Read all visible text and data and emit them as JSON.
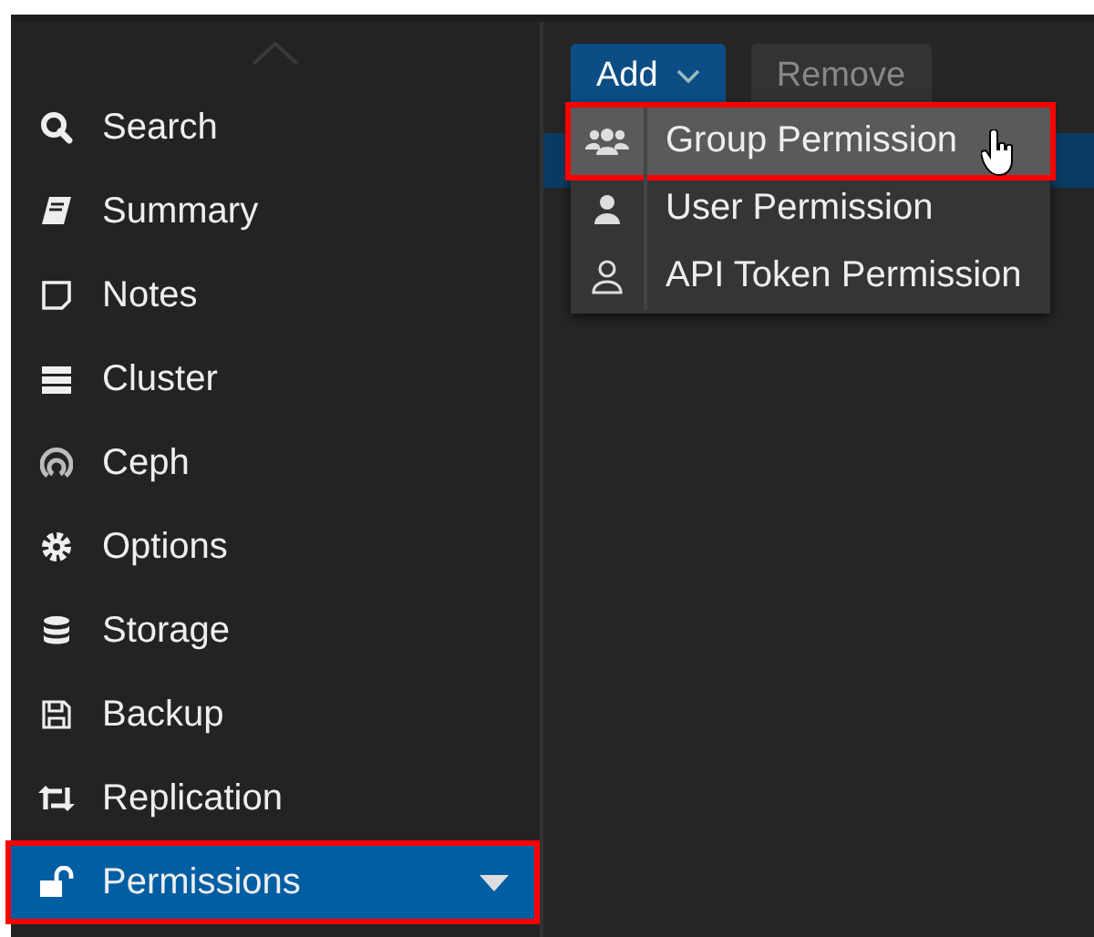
{
  "sidebar": {
    "items": [
      {
        "label": "Search",
        "selected": false,
        "highlighted": false,
        "expandable": false
      },
      {
        "label": "Summary",
        "selected": false,
        "highlighted": false,
        "expandable": false
      },
      {
        "label": "Notes",
        "selected": false,
        "highlighted": false,
        "expandable": false
      },
      {
        "label": "Cluster",
        "selected": false,
        "highlighted": false,
        "expandable": false
      },
      {
        "label": "Ceph",
        "selected": false,
        "highlighted": false,
        "expandable": false
      },
      {
        "label": "Options",
        "selected": false,
        "highlighted": false,
        "expandable": false
      },
      {
        "label": "Storage",
        "selected": false,
        "highlighted": false,
        "expandable": false
      },
      {
        "label": "Backup",
        "selected": false,
        "highlighted": false,
        "expandable": false
      },
      {
        "label": "Replication",
        "selected": false,
        "highlighted": false,
        "expandable": false
      },
      {
        "label": "Permissions",
        "selected": true,
        "highlighted": true,
        "expandable": true
      }
    ]
  },
  "toolbar": {
    "buttons": [
      {
        "label": "Add",
        "kind": "menu",
        "disabled": false
      },
      {
        "label": "Remove",
        "kind": "plain",
        "disabled": true
      }
    ]
  },
  "table": {
    "rows": [
      {
        "selected": true
      }
    ]
  },
  "menu": {
    "items": [
      {
        "label": "Group Permission",
        "selected": true,
        "highlighted": true
      },
      {
        "label": "User Permission",
        "selected": false,
        "highlighted": false
      },
      {
        "label": "API Token Permission",
        "selected": false,
        "highlighted": false
      }
    ]
  }
}
